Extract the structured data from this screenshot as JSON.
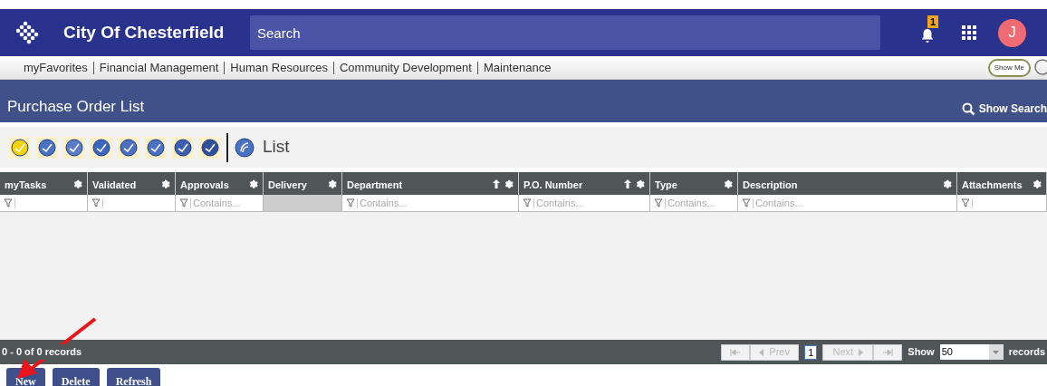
{
  "header": {
    "title": "City Of Chesterfield",
    "search_placeholder": "Search",
    "notification_count": "1",
    "avatar_initial": "J"
  },
  "menu": {
    "items": [
      "myFavorites",
      "Financial Management",
      "Human Resources",
      "Community Development",
      "Maintenance"
    ],
    "show_me": "Show Me"
  },
  "page": {
    "title": "Purchase Order List",
    "show_search": "Show Search"
  },
  "toolbar": {
    "view_label": "List"
  },
  "table": {
    "columns": [
      {
        "label": "myTasks",
        "sorted": false,
        "filter_disabled": false
      },
      {
        "label": "Validated",
        "sorted": false,
        "filter_disabled": false
      },
      {
        "label": "Approvals",
        "sorted": false,
        "filter": "Contains...",
        "filter_disabled": false
      },
      {
        "label": "Delivery",
        "sorted": false,
        "filter_disabled": true
      },
      {
        "label": "Department",
        "sorted": true,
        "filter": "Contains...",
        "filter_disabled": false
      },
      {
        "label": "P.O. Number",
        "sorted": true,
        "filter": "Contains...",
        "filter_disabled": false
      },
      {
        "label": "Type",
        "sorted": false,
        "filter": "Contains...",
        "filter_disabled": false
      },
      {
        "label": "Description",
        "sorted": false,
        "filter": "Contains...",
        "filter_disabled": false
      },
      {
        "label": "Attachments",
        "sorted": false,
        "filter_disabled": false
      }
    ]
  },
  "pager": {
    "summary": "0 - 0 of 0 records",
    "prev": "Prev",
    "page": "1",
    "next": "Next",
    "show": "Show",
    "page_size": "50",
    "records": "records"
  },
  "buttons": [
    "New",
    "Delete",
    "Refresh"
  ]
}
